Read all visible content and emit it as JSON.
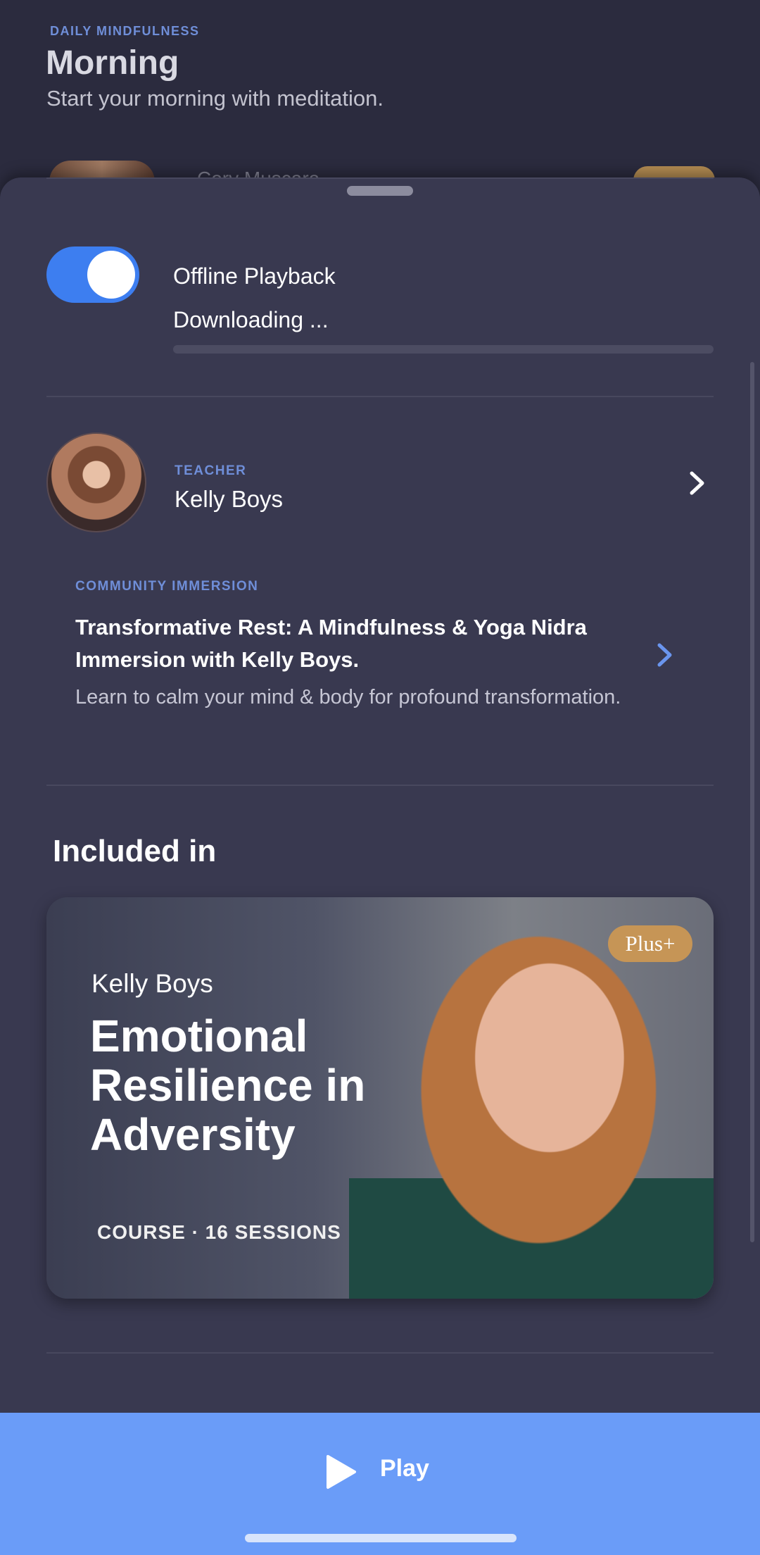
{
  "header": {
    "eyebrow": "DAILY MINDFULNESS",
    "title": "Morning",
    "subtitle": "Start your morning with meditation.",
    "peek_name": "Cory Muscara"
  },
  "offline": {
    "label": "Offline Playback",
    "enabled": true,
    "status": "Downloading ...",
    "progress": 0.0
  },
  "teacher": {
    "eyebrow": "TEACHER",
    "name": "Kelly Boys"
  },
  "community": {
    "eyebrow": "COMMUNITY IMMERSION",
    "title": "Transformative Rest: A Mindfulness & Yoga Nidra Immersion with Kelly Boys.",
    "description": "Learn to calm your mind & body for profound transformation."
  },
  "included": {
    "heading": "Included in",
    "course": {
      "teacher": "Kelly Boys",
      "title": "Emotional Resilience in Adversity",
      "meta": "COURSE · 16 SESSIONS",
      "badge": "Plus+"
    }
  },
  "play": {
    "label": "Play"
  },
  "colors": {
    "accent": "#6a9cf8",
    "toggle_on": "#3d7ef0",
    "eyebrow": "#6f8ed8",
    "sheet": "#393950",
    "badge": "#c69556"
  },
  "icons": {
    "teacher_chevron": "chevron-right-icon",
    "community_chevron": "chevron-right-icon",
    "play": "play-icon"
  }
}
